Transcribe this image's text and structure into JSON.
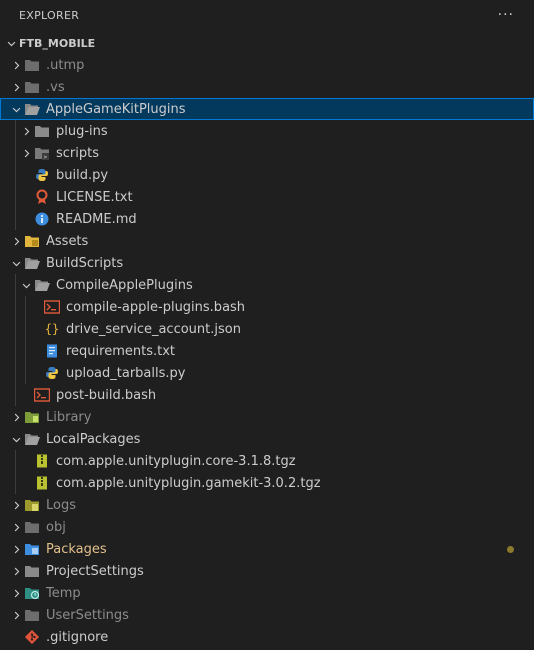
{
  "explorer": {
    "title": "EXPLORER",
    "more_label": "···"
  },
  "workspace": {
    "name": "FTB_MOBILE"
  },
  "tree": {
    "utmp": ".utmp",
    "vs": ".vs",
    "agkp": "AppleGameKitPlugins",
    "plugins": "plug-ins",
    "scripts": "scripts",
    "buildpy": "build.py",
    "license": "LICENSE.txt",
    "readme": "README.md",
    "assets": "Assets",
    "buildscripts": "BuildScripts",
    "compileapple": "CompileApplePlugins",
    "compilebash": "compile-apple-plugins.bash",
    "driveservice": "drive_service_account.json",
    "requirements": "requirements.txt",
    "upload": "upload_tarballs.py",
    "postbuild": "post-build.bash",
    "library": "Library",
    "localpackages": "LocalPackages",
    "core": "com.apple.unityplugin.core-3.1.8.tgz",
    "gamekit": "com.apple.unityplugin.gamekit-3.0.2.tgz",
    "logs": "Logs",
    "obj": "obj",
    "packages": "Packages",
    "projectsettings": "ProjectSettings",
    "temp": "Temp",
    "usersettings": "UserSettings",
    "gitignore": ".gitignore"
  },
  "colors": {
    "background": "#1f1f1f",
    "selection": "#04395e",
    "modified": "#e2c08d",
    "folder": "#7a7a7a"
  }
}
